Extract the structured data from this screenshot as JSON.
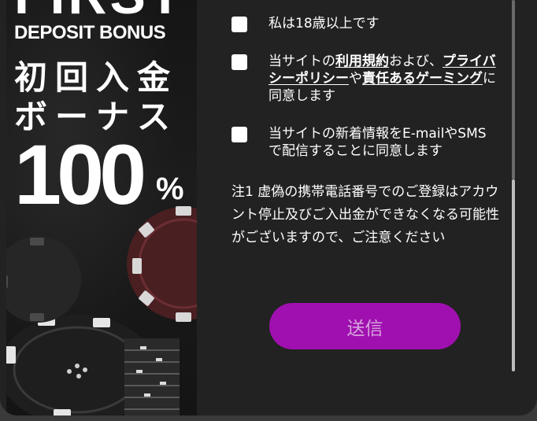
{
  "banner": {
    "headline": "FIRST",
    "subheadline": "DEPOSIT BONUS",
    "jp_line1": "初回入金",
    "jp_line2": "ボーナス",
    "percent_value": "100",
    "percent_sign": "%"
  },
  "form": {
    "age_checkbox": {
      "label": "私は18歳以上です",
      "checked": false
    },
    "terms_checkbox": {
      "prefix": "当サイトの",
      "terms_link": "利用規約",
      "and_text": "および、",
      "privacy_link": "プライバシーポリシー",
      "ya_text": "や",
      "responsible_link": "責任あるゲーミング",
      "suffix": "に同意します",
      "checked": false
    },
    "newsletter_checkbox": {
      "label": "当サイトの新着情報をE-mailやSMSで配信することに同意します",
      "checked": false
    },
    "note": "注1 虚偽の携帯電話番号でのご登録はアカウント停止及びご入出金ができなくなる可能性がございますので、ご注意ください",
    "submit_label": "送信"
  },
  "colors": {
    "panel_background": "#222222",
    "submit_background": "#a010b0",
    "submit_text": "#d7a3dc",
    "checkbox": "#ffffff",
    "scrollbar_thumb": "#bdbdbd"
  },
  "icons": {
    "banner_decoration": "casino-chips-illustration"
  }
}
